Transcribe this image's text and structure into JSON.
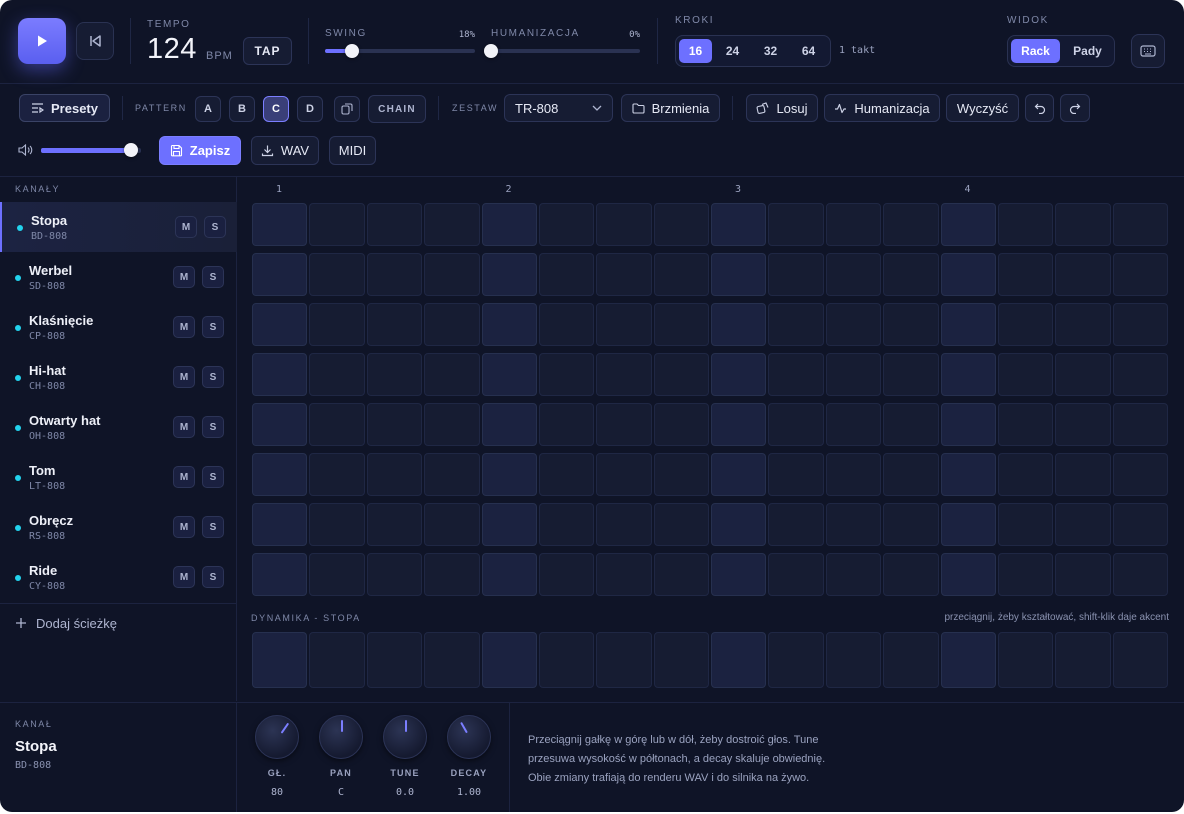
{
  "transport": {
    "play_icon": "play-icon",
    "rewind_icon": "skip-back-icon"
  },
  "tempo": {
    "label": "TEMPO",
    "value": "124",
    "unit": "BPM",
    "tap_label": "TAP"
  },
  "swing": {
    "label": "SWING",
    "value": "18%",
    "level": 0.18
  },
  "humanize": {
    "label": "HUMANIZACJA",
    "value": "0%",
    "level": 0
  },
  "steps": {
    "label": "KROKI",
    "options": [
      "16",
      "24",
      "32",
      "64"
    ],
    "selected": "16",
    "bars": "1 takt"
  },
  "view": {
    "label": "WIDOK",
    "options": [
      "Rack",
      "Pady"
    ],
    "selected": "Rack"
  },
  "toolbar": {
    "presets_label": "Presety",
    "pattern_label": "PATTERN",
    "patterns": [
      "A",
      "B",
      "C",
      "D"
    ],
    "selected_pattern": "C",
    "chain_label": "CHAIN",
    "kit_label": "ZESTAW",
    "kit_value": "TR-808",
    "sounds_label": "Brzmienia",
    "random_label": "Losuj",
    "humanize_label": "Humanizacja",
    "clear_label": "Wyczyść",
    "save_label": "Zapisz",
    "wav_label": "WAV",
    "midi_label": "MIDI",
    "volume_level": 0.9
  },
  "channels": {
    "label": "KANAŁY",
    "add_label": "Dodaj ścieżkę",
    "mute_label": "M",
    "solo_label": "S",
    "tracks": [
      {
        "name": "Stopa",
        "code": "BD-808",
        "selected": true
      },
      {
        "name": "Werbel",
        "code": "SD-808"
      },
      {
        "name": "Klaśnięcie",
        "code": "CP-808"
      },
      {
        "name": "Hi-hat",
        "code": "CH-808"
      },
      {
        "name": "Otwarty hat",
        "code": "OH-808"
      },
      {
        "name": "Tom",
        "code": "LT-808"
      },
      {
        "name": "Obręcz",
        "code": "RS-808"
      },
      {
        "name": "Ride",
        "code": "CY-808"
      }
    ]
  },
  "grid": {
    "beats": [
      "1",
      "2",
      "3",
      "4"
    ],
    "steps": 16
  },
  "dynamics": {
    "label": "DYNAMIKA - STOPA",
    "hint": "przeciągnij, żeby kształtować, shift-klik daje akcent"
  },
  "channel_panel": {
    "label": "KANAŁ",
    "name": "Stopa",
    "code": "BD-808"
  },
  "knobs": [
    {
      "label": "GŁ.",
      "value": "80"
    },
    {
      "label": "PAN",
      "value": "C"
    },
    {
      "label": "TUNE",
      "value": "0.0"
    },
    {
      "label": "DECAY",
      "value": "1.00"
    }
  ],
  "help": {
    "lines": [
      "Przeciągnij gałkę w górę lub w dół, żeby dostroić głos. Tune",
      "przesuwa wysokość w półtonach, a decay skaluje obwiednię.",
      "Obie zmiany trafiają do renderu WAV i do silnika na żywo."
    ]
  },
  "colors": {
    "accent": "#6d70ff",
    "track_dot": "#22d3ee",
    "background": "#0f1427"
  }
}
